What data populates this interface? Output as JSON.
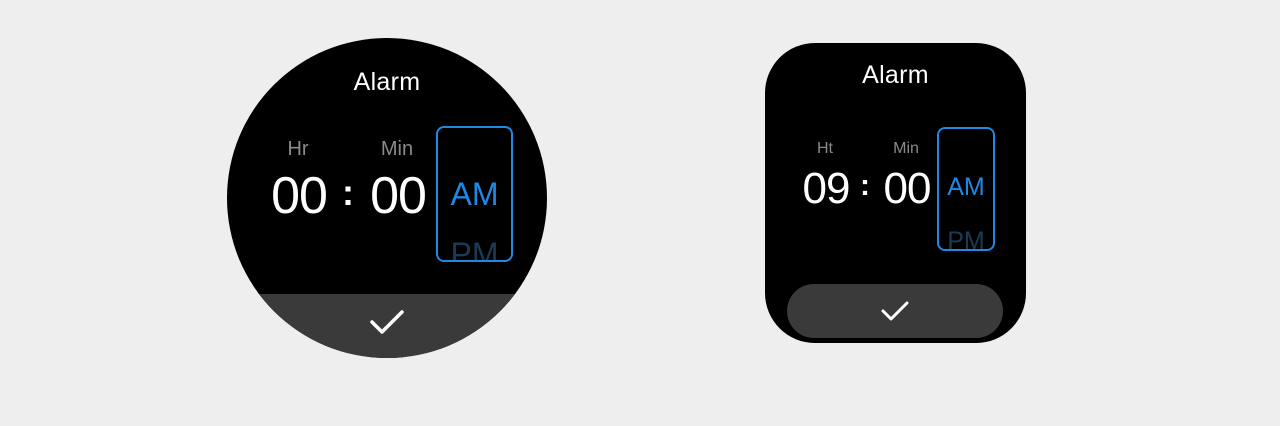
{
  "round_watch": {
    "title": "Alarm",
    "hour_label": "Hr",
    "minute_label": "Min",
    "hour_value": "00",
    "separator": ":",
    "minute_value": "00",
    "period_selected": "AM",
    "period_other": "PM",
    "confirm_icon": "check-icon"
  },
  "rect_watch": {
    "title": "Alarm",
    "hour_label": "Ht",
    "minute_label": "Min",
    "hour_value": "09",
    "separator": ":",
    "minute_value": "00",
    "period_selected": "AM",
    "period_other": "PM",
    "confirm_icon": "check-icon"
  },
  "colors": {
    "background": "#eeeeee",
    "watch_face": "#000000",
    "accent": "#1e88e5",
    "confirm_bar": "#3a3a3a",
    "label_gray": "#8a8a8a"
  }
}
